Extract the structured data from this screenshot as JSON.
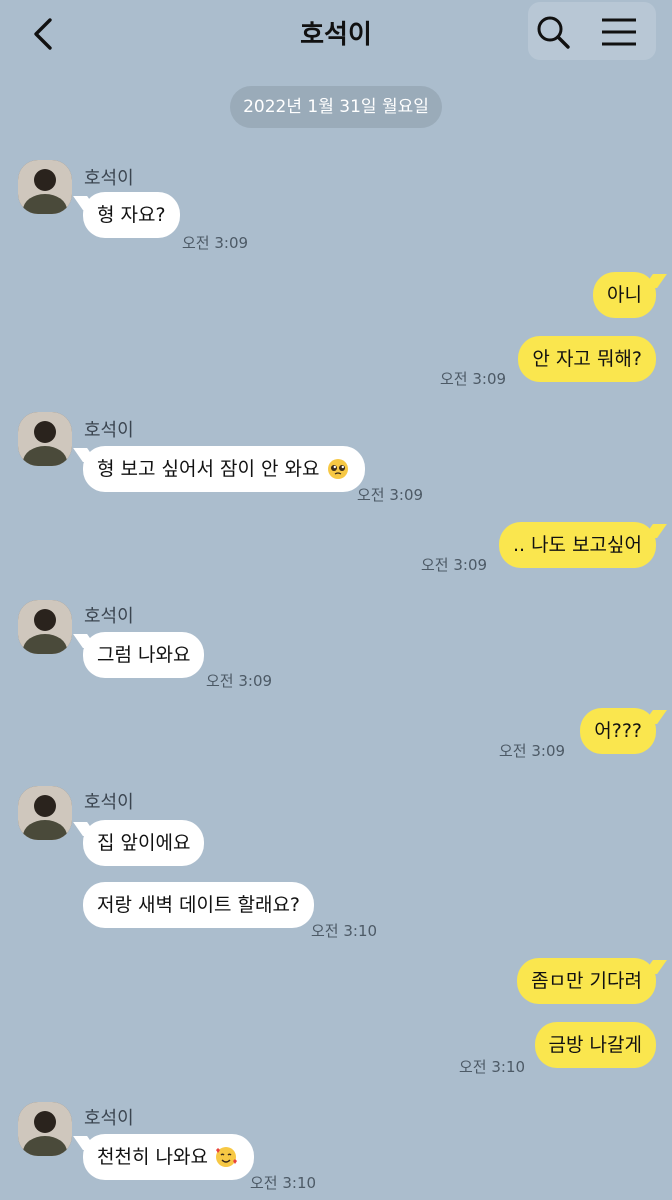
{
  "header": {
    "title": "호석이",
    "ghost_text": "..."
  },
  "date_label": "2022년 1월 31일 월요일",
  "contact_name": "호석이",
  "messages": [
    {
      "text": "형 자요?",
      "time": "오전 3:09"
    },
    {
      "text": "아니",
      "time": ""
    },
    {
      "text": "안 자고 뭐해?",
      "time": "오전 3:09"
    },
    {
      "text": "형 보고 싶어서 잠이 안 와요",
      "time": "오전 3:09"
    },
    {
      "text": ".. 나도 보고싶어",
      "time": "오전 3:09"
    },
    {
      "text": "그럼 나와요",
      "time": "오전 3:09"
    },
    {
      "text": "어???",
      "time": "오전 3:09"
    },
    {
      "text": "집 앞이에요",
      "time": ""
    },
    {
      "text": "저랑 새벽 데이트 할래요?",
      "time": "오전 3:10"
    },
    {
      "text": "좀ㅁ만 기다려",
      "time": ""
    },
    {
      "text": "금방 나갈게",
      "time": "오전 3:10"
    },
    {
      "text": "천천히 나와요",
      "time": "오전 3:10"
    }
  ]
}
